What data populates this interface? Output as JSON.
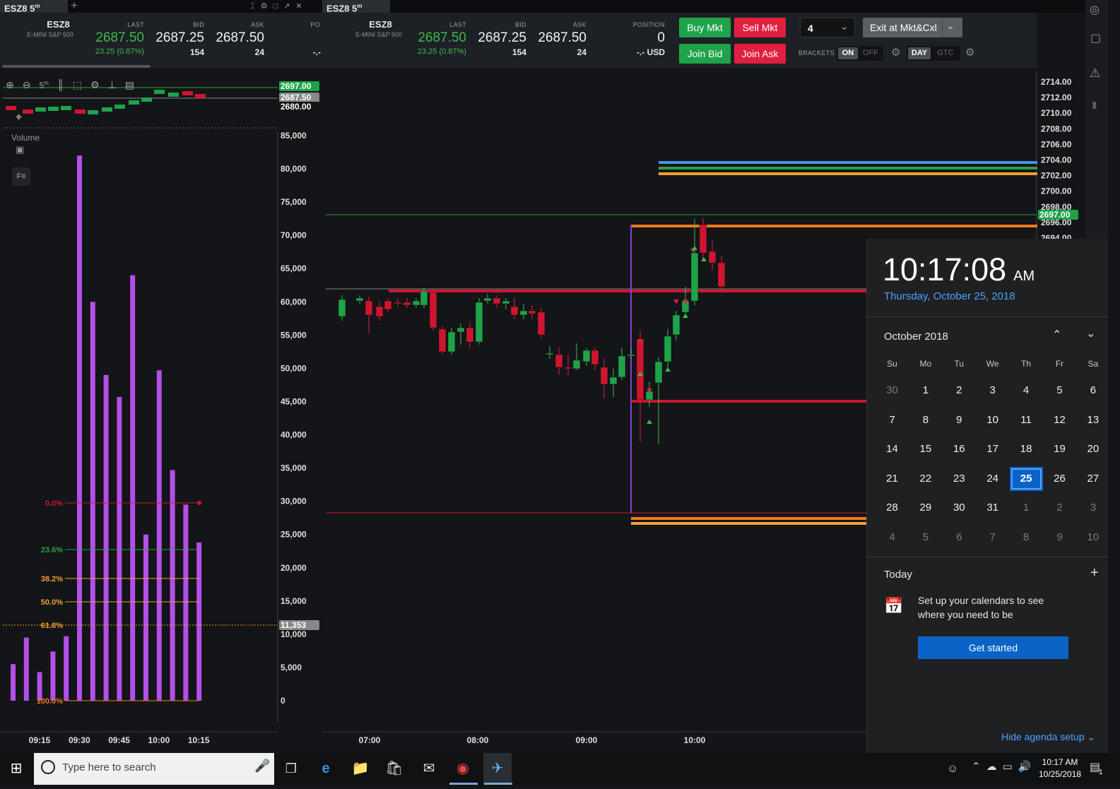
{
  "left_panel": {
    "tab_title": "ESZ8 5",
    "tab_sup": "m",
    "add_tab": "+",
    "symbol": "ESZ8",
    "symbol_desc": "E-MINI S&P 500",
    "last_label": "LAST",
    "last_value": "2687.50",
    "last_change": "23.25 (0.87%)",
    "bid_label": "BID",
    "bid_value": "2687.25",
    "bid_size": "154",
    "ask_label": "ASK",
    "ask_value": "2687.50",
    "ask_size": "24",
    "pos_label": "PO",
    "pos_value": "-.-",
    "interval": "5",
    "interval_sup": "m",
    "volume_label": "Volume",
    "price_tags": [
      "2697.00",
      "2687.50",
      "2680.00"
    ],
    "volume_axis": [
      "85,000",
      "80,000",
      "75,000",
      "70,000",
      "65,000",
      "60,000",
      "55,000",
      "50,000",
      "45,000",
      "40,000",
      "35,000",
      "30,000",
      "25,000",
      "20,000",
      "15,000",
      "10,000",
      "5,000",
      "0"
    ],
    "volume_tag": "11,353",
    "fib_levels": [
      "0.0%",
      "23.6%",
      "38.2%",
      "50.0%",
      "61.8%",
      "100.0%"
    ],
    "time_axis": [
      "09:15",
      "09:30",
      "09:45",
      "10:00",
      "10:15"
    ],
    "bars": [
      {
        "time": "09:05",
        "volume": 5500
      },
      {
        "time": "09:10",
        "volume": 9500
      },
      {
        "time": "09:15",
        "volume": 4300
      },
      {
        "time": "09:20",
        "volume": 7400
      },
      {
        "time": "09:25",
        "volume": 9700
      },
      {
        "time": "09:30",
        "volume": 82000
      },
      {
        "time": "09:35",
        "volume": 60000
      },
      {
        "time": "09:40",
        "volume": 49000
      },
      {
        "time": "09:45",
        "volume": 45700
      },
      {
        "time": "09:50",
        "volume": 64000
      },
      {
        "time": "09:55",
        "volume": 25000
      },
      {
        "time": "10:00",
        "volume": 49700
      },
      {
        "time": "10:05",
        "volume": 34700
      },
      {
        "time": "10:10",
        "volume": 29500
      },
      {
        "time": "10:15",
        "volume": 23800
      }
    ]
  },
  "main_panel": {
    "tab_title": "ESZ8 5",
    "tab_sup": "m",
    "symbol": "ESZ8",
    "symbol_desc": "E-MINI S&P 500",
    "last_label": "LAST",
    "last_value": "2687.50",
    "last_change": "23.25 (0.87%)",
    "bid_label": "BID",
    "bid_value": "2687.25",
    "bid_size": "154",
    "ask_label": "ASK",
    "ask_value": "2687.50",
    "ask_size": "24",
    "position_label": "POSITION",
    "position_value": "0",
    "position_usd": "-.- USD",
    "buy_mkt": "Buy Mkt",
    "sell_mkt": "Sell Mkt",
    "join_bid": "Join Bid",
    "join_ask": "Join Ask",
    "quantity": "4",
    "exit_button": "Exit at Mkt&Cxl",
    "brackets_label": "BRACKETS",
    "on": "ON",
    "off": "OFF",
    "day": "DAY",
    "gtc": "GTC",
    "price_axis": [
      "2714.00",
      "2712.00",
      "2710.00",
      "2708.00",
      "2706.00",
      "2704.00",
      "2702.00",
      "2700.00",
      "2698.00",
      "2696.00",
      "2694.00"
    ],
    "price_tag": "2697.00",
    "time_axis": [
      "07:00",
      "08:00",
      "09:00",
      "10:00"
    ]
  },
  "calendar": {
    "time": "10:17:08",
    "ampm": "AM",
    "date": "Thursday, October 25, 2018",
    "month": "October 2018",
    "weekdays": [
      "Su",
      "Mo",
      "Tu",
      "We",
      "Th",
      "Fr",
      "Sa"
    ],
    "days": [
      [
        "30",
        "1",
        "2",
        "3",
        "4",
        "5",
        "6"
      ],
      [
        "7",
        "8",
        "9",
        "10",
        "11",
        "12",
        "13"
      ],
      [
        "14",
        "15",
        "16",
        "17",
        "18",
        "19",
        "20"
      ],
      [
        "21",
        "22",
        "23",
        "24",
        "25",
        "26",
        "27"
      ],
      [
        "28",
        "29",
        "30",
        "31",
        "1",
        "2",
        "3"
      ],
      [
        "4",
        "5",
        "6",
        "7",
        "8",
        "9",
        "10"
      ]
    ],
    "selected": "25",
    "today_label": "Today",
    "agenda_text_1": "Set up your calendars to see",
    "agenda_text_2": "where you need to be",
    "get_started": "Get started",
    "hide_agenda": "Hide agenda setup"
  },
  "taskbar": {
    "search_placeholder": "Type here to search",
    "clock_time": "10:17 AM",
    "clock_date": "10/25/2018",
    "notif_count": "1"
  },
  "colors": {
    "green": "#3fb950",
    "red": "#e0203f",
    "purple": "#b44fe8",
    "orange": "#f07b1a",
    "win_blue": "#0a64c8"
  }
}
